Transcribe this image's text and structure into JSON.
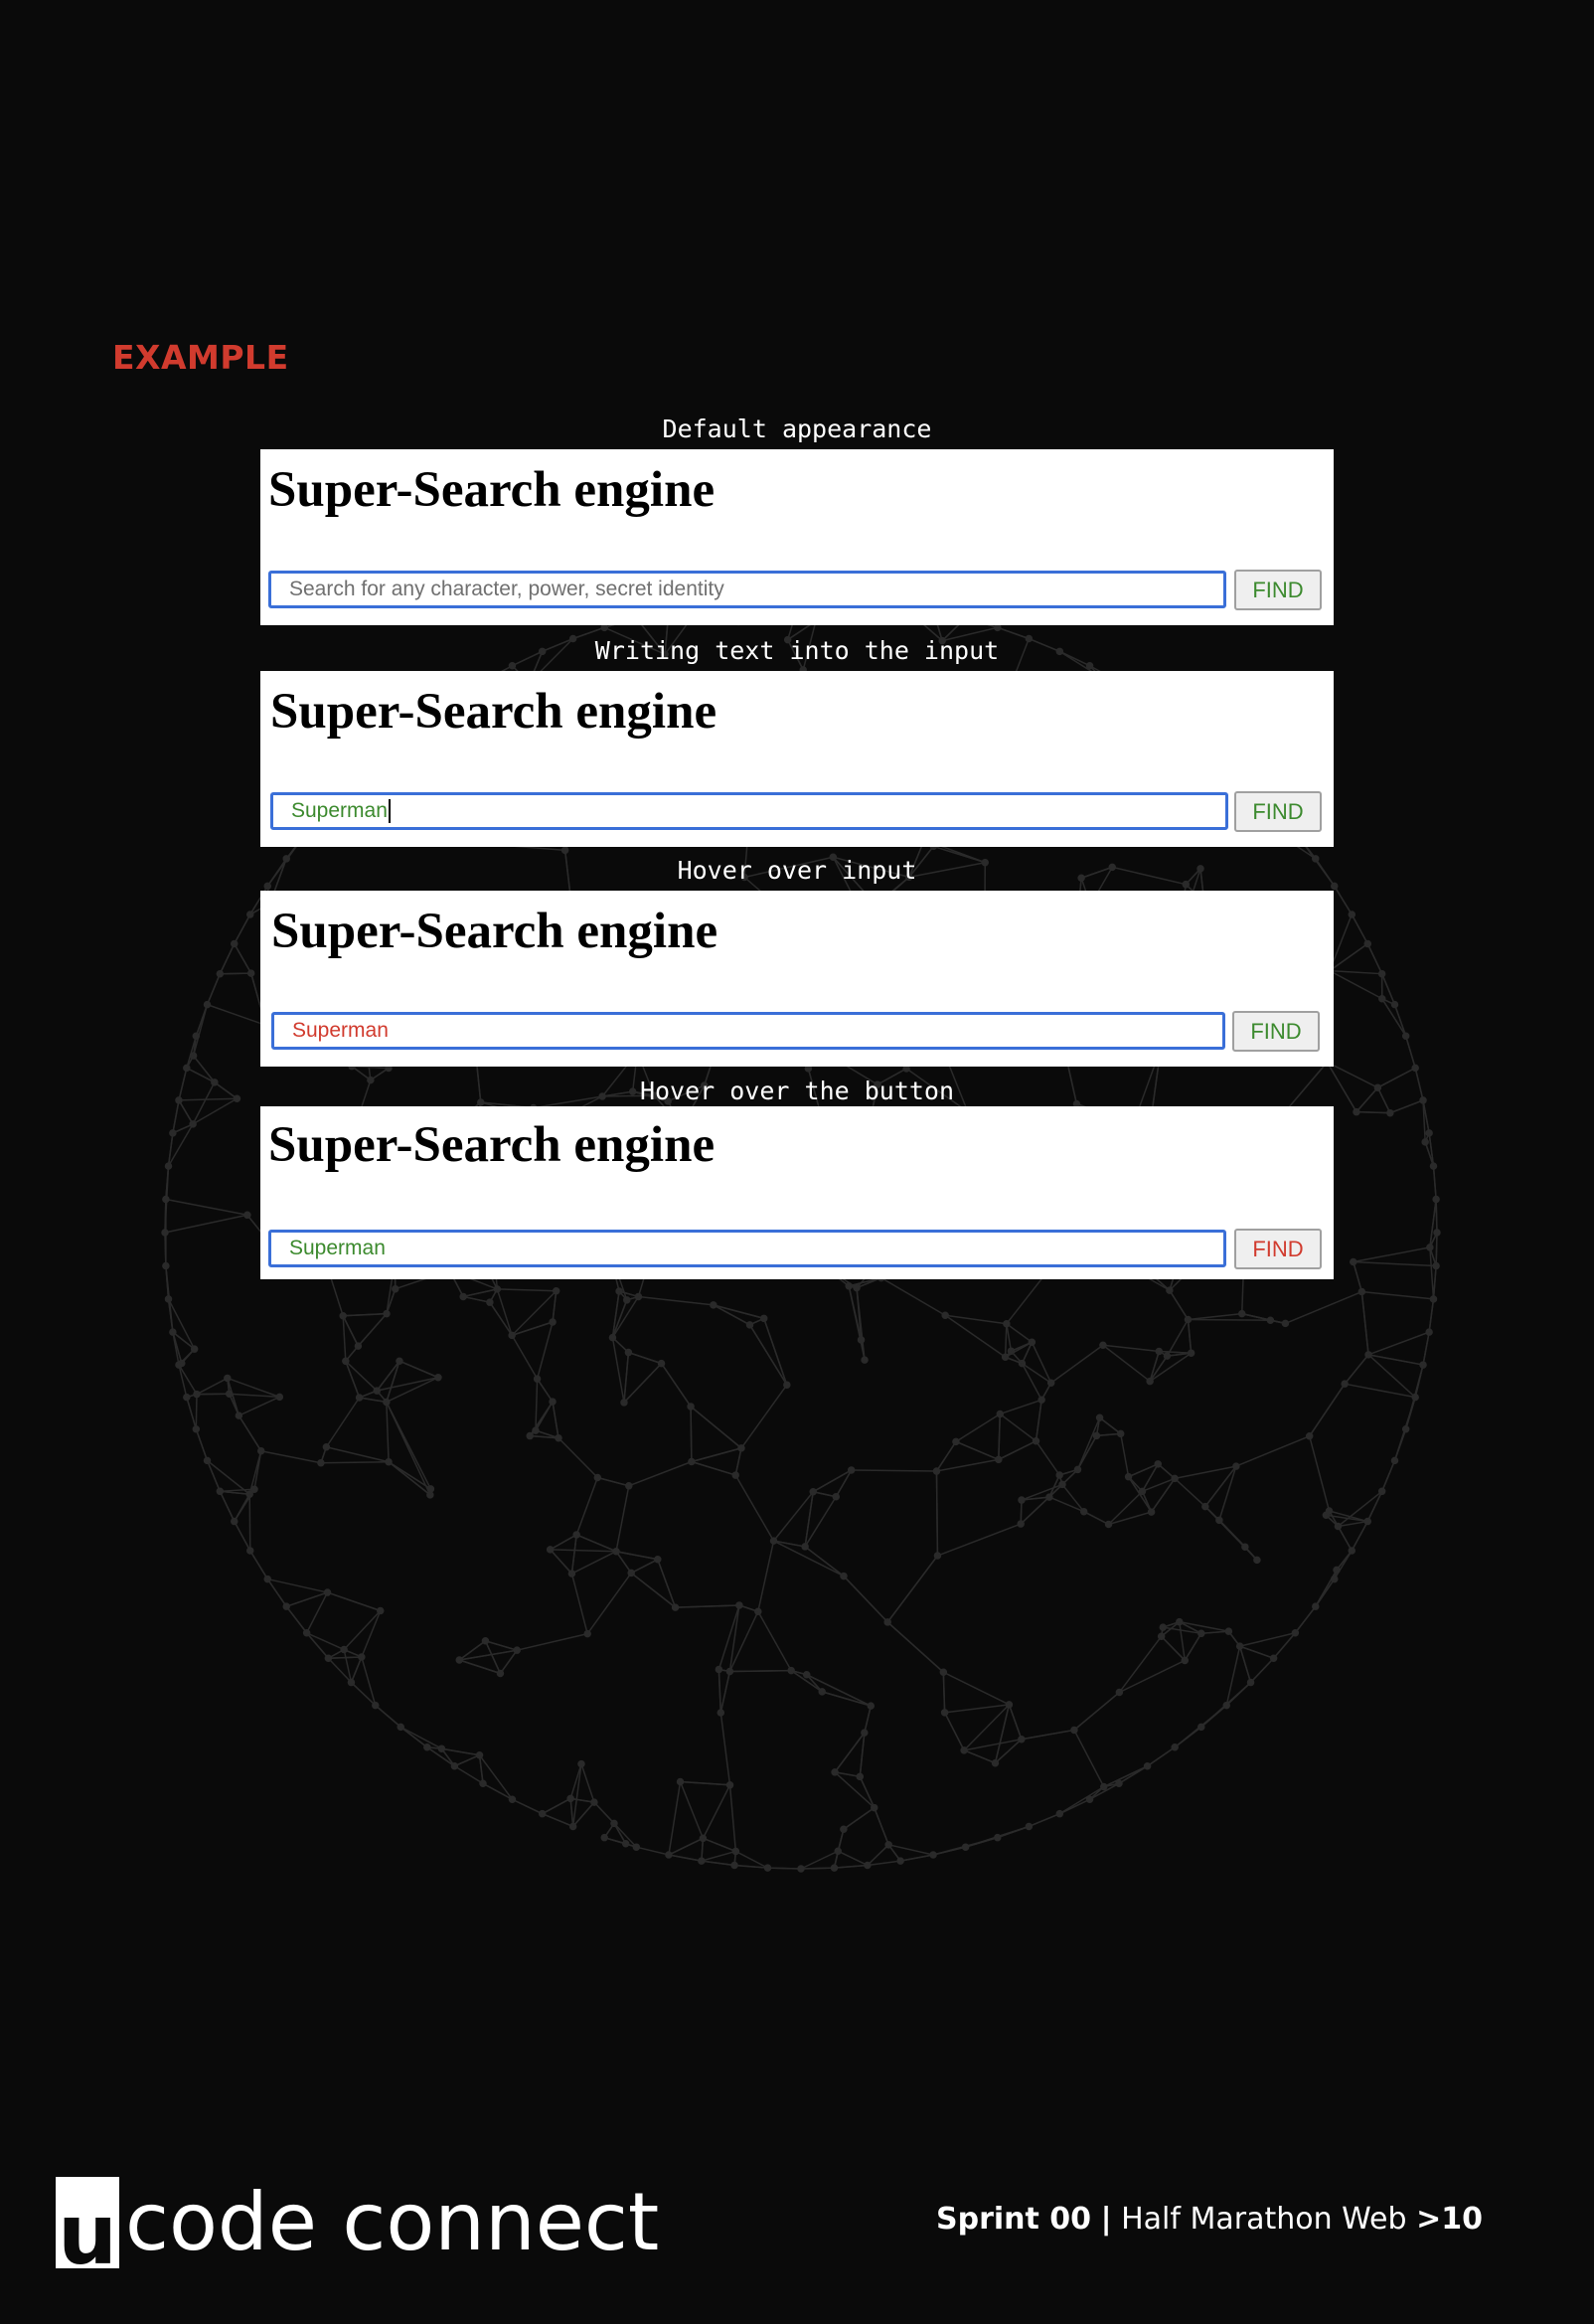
{
  "example_heading": "EXAMPLE",
  "panels": [
    {
      "caption": "Default appearance",
      "title": "Super-Search engine",
      "input_placeholder": "Search for any character, power, secret identity",
      "input_value": "",
      "button_label": "FIND"
    },
    {
      "caption": "Writing text into the input",
      "title": "Super-Search engine",
      "input_value": "Superman",
      "button_label": "FIND"
    },
    {
      "caption": "Hover over input",
      "title": "Super-Search engine",
      "input_value": "Superman",
      "button_label": "FIND"
    },
    {
      "caption": "Hover over the button",
      "title": "Super-Search engine",
      "input_value": "Superman",
      "button_label": "FIND"
    }
  ],
  "colors": {
    "accent_red": "#d13b2e",
    "text_green": "#3c8a2e",
    "input_border": "#3a6fd8",
    "background": "#0a0a0a"
  },
  "footer": {
    "logo_letter": "u",
    "logo_text": "code connect",
    "sprint": "Sprint 00",
    "separator": "|",
    "course": "Half Marathon Web",
    "arrow": ">",
    "page_number": "10"
  }
}
